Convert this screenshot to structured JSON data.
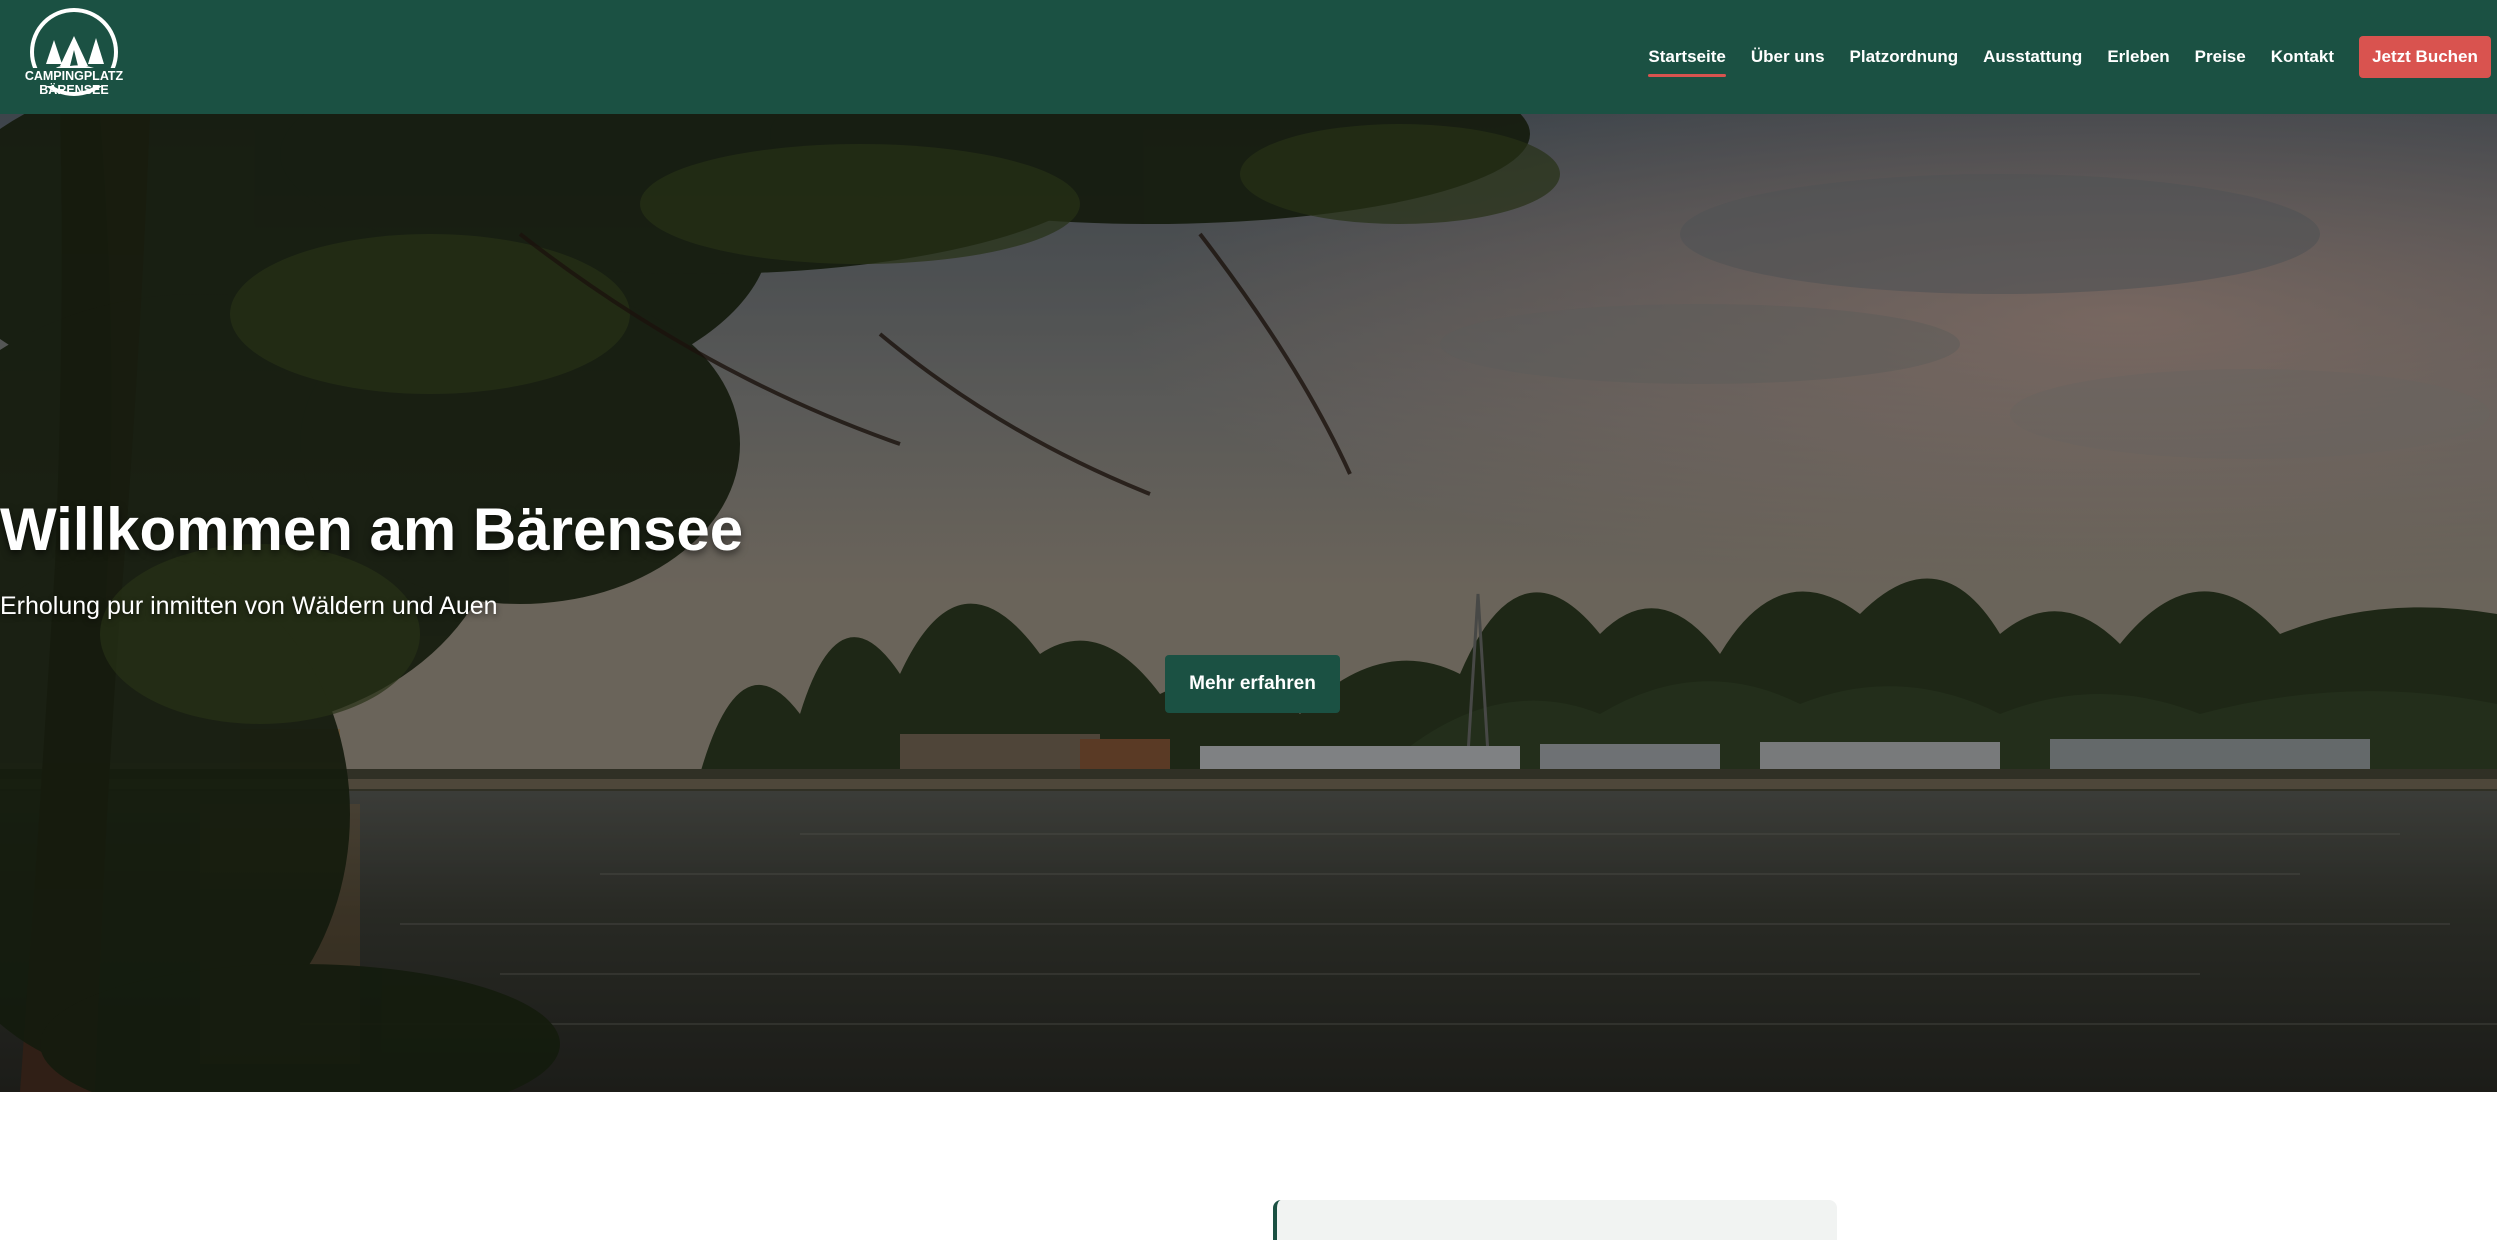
{
  "header": {
    "logo": {
      "line1": "CAMPINGPLATZ",
      "line2": "BÄRENSEE",
      "icon": "bear-tent-icon"
    },
    "nav": [
      {
        "label": "Startseite",
        "active": true
      },
      {
        "label": "Über uns",
        "active": false
      },
      {
        "label": "Platzordnung",
        "active": false
      },
      {
        "label": "Ausstattung",
        "active": false
      },
      {
        "label": "Erleben",
        "active": false
      },
      {
        "label": "Preise",
        "active": false
      },
      {
        "label": "Kontakt",
        "active": false
      }
    ],
    "cta_label": "Jetzt Buchen"
  },
  "hero": {
    "title": "Willkommen am Bärensee",
    "subtitle": "Erholung pur inmitten von Wäldern und Auen",
    "button_label": "Mehr erfahren",
    "image": "lake-campsite-photo"
  },
  "colors": {
    "brand_green": "#1b5143",
    "accent_red": "#d9534f"
  }
}
